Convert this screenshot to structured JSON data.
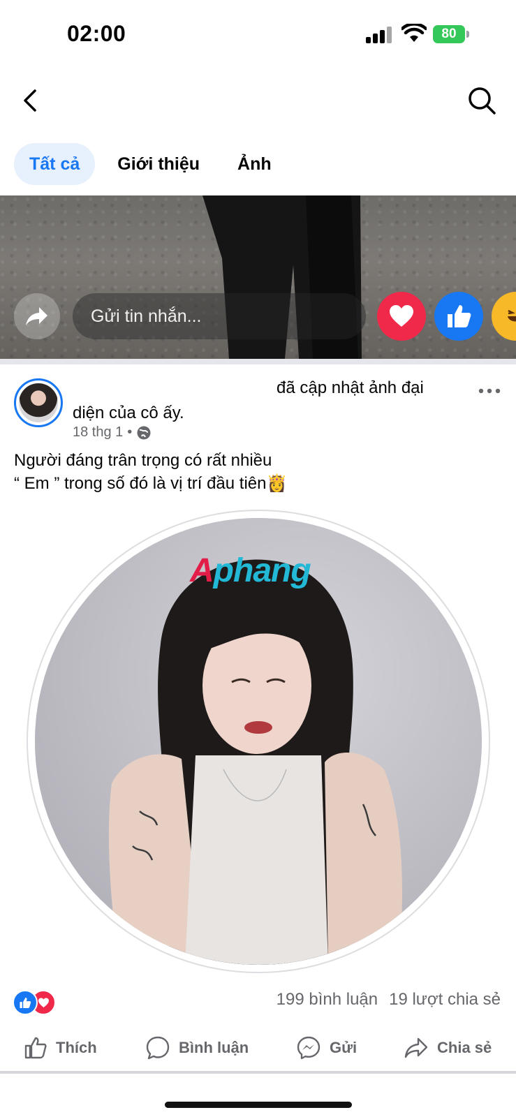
{
  "status_bar": {
    "time": "02:00",
    "battery": "80",
    "icons": [
      "signal-icon",
      "wifi-icon",
      "battery-icon"
    ]
  },
  "nav": {
    "back_icon": "chevron-left-icon",
    "search_icon": "search-icon"
  },
  "tabs": [
    {
      "label": "Tất cả",
      "active": true
    },
    {
      "label": "Giới thiệu",
      "active": false
    },
    {
      "label": "Ảnh",
      "active": false
    }
  ],
  "story": {
    "message_placeholder": "Gửi tin nhắn...",
    "reactions": [
      "love-icon",
      "like-icon",
      "haha-icon"
    ]
  },
  "post": {
    "action_text": "đã cập nhật ảnh đại diện của cô ấy.",
    "date": "18 thg 1",
    "separator": "•",
    "privacy_icon": "globe-icon",
    "caption_line1": "Người đáng trân trọng có rất nhiều",
    "caption_line2": "“ Em ” trong số đó là vị trí đầu tiên",
    "caption_emoji": "👸",
    "watermark_part1": "A",
    "watermark_part2": "phang",
    "comments": "199 bình luận",
    "shares": "19 lượt chia sẻ"
  },
  "actions": {
    "like": "Thích",
    "comment": "Bình luận",
    "send": "Gửi",
    "share": "Chia sẻ"
  },
  "colors": {
    "accent": "#1877f2",
    "tab_active_bg": "#e7f0fd",
    "love": "#f02849",
    "battery": "#34c759",
    "muted_text": "#65676b"
  }
}
